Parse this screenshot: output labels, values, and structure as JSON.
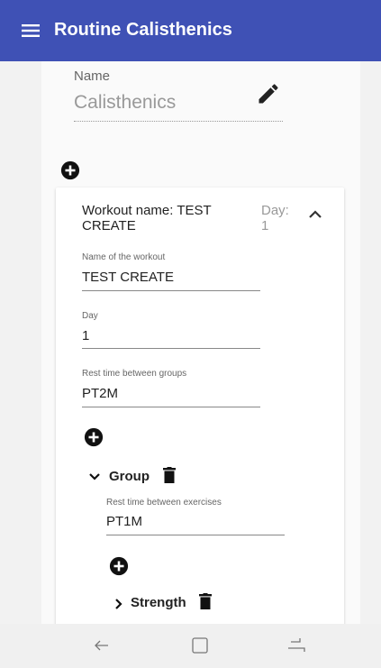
{
  "app_bar": {
    "title": "Routine Calisthenics"
  },
  "routine": {
    "name_label": "Name",
    "name_value": "Calisthenics"
  },
  "workout": {
    "title": "Workout name: TEST CREATE",
    "day_label": "Day: 1",
    "fields": [
      {
        "label": "Name of the workout",
        "value": "TEST CREATE"
      },
      {
        "label": "Day",
        "value": "1"
      },
      {
        "label": "Rest time between groups",
        "value": "PT2M"
      }
    ]
  },
  "group": {
    "label": "Group",
    "rest_label": "Rest time between exercises",
    "rest_value": "PT1M"
  },
  "exercise": {
    "label": "Strength"
  },
  "colors": {
    "app_bar": "#3f51b5",
    "background": "#f2f2f2"
  },
  "icons": {
    "menu": "menu-icon",
    "edit": "pencil-icon",
    "add": "add-circle-icon",
    "collapse": "chevron-up-icon",
    "expand": "chevron-down-icon",
    "expand_right": "chevron-right-icon",
    "delete": "trash-icon",
    "nav_back": "back-icon",
    "nav_home": "home-icon",
    "nav_recent": "recent-apps-icon"
  }
}
